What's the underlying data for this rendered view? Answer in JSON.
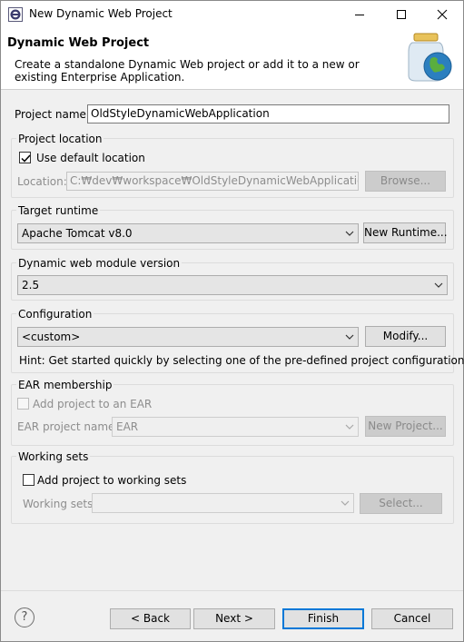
{
  "window": {
    "title": "New Dynamic Web Project"
  },
  "header": {
    "title": "Dynamic Web Project",
    "description": "Create a standalone Dynamic Web project or add it to a new or existing Enterprise Application."
  },
  "project_name": {
    "label": "Project name:",
    "value": "OldStyleDynamicWebApplication"
  },
  "project_location": {
    "group_title": "Project location",
    "use_default_label": "Use default location",
    "use_default_checked": true,
    "location_label": "Location:",
    "location_value": "C:₩dev₩workspace₩OldStyleDynamicWebApplication",
    "browse_label": "Browse..."
  },
  "target_runtime": {
    "group_title": "Target runtime",
    "selected": "Apache Tomcat v8.0",
    "new_runtime_label": "New Runtime..."
  },
  "module_version": {
    "group_title": "Dynamic web module version",
    "selected": "2.5"
  },
  "configuration": {
    "group_title": "Configuration",
    "selected": "<custom>",
    "modify_label": "Modify...",
    "hint": "Hint: Get started quickly by selecting one of the pre-defined project configurations."
  },
  "ear_membership": {
    "group_title": "EAR membership",
    "add_label": "Add project to an EAR",
    "add_checked": false,
    "project_name_label": "EAR project name:",
    "project_name_value": "EAR",
    "new_project_label": "New Project..."
  },
  "working_sets": {
    "group_title": "Working sets",
    "add_label": "Add project to working sets",
    "add_checked": false,
    "label": "Working sets:",
    "value": "",
    "select_label": "Select..."
  },
  "footer": {
    "help_symbol": "?",
    "back_label": "< Back",
    "next_label": "Next >",
    "finish_label": "Finish",
    "cancel_label": "Cancel"
  },
  "colors": {
    "focus_blue": "#0078d7",
    "dialog_bg": "#f0f0f0",
    "disabled_text": "#8d8d8d"
  }
}
